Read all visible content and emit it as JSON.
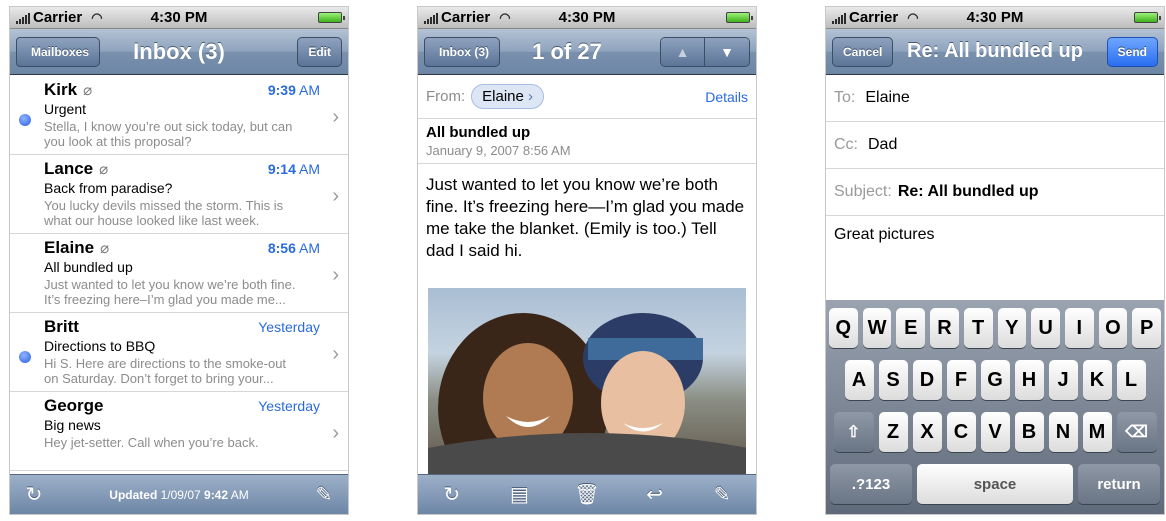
{
  "status": {
    "carrier": "Carrier",
    "time": "4:30 PM"
  },
  "inbox": {
    "back_label": "Mailboxes",
    "title": "Inbox (3)",
    "edit_label": "Edit",
    "messages": [
      {
        "sender": "Kirk",
        "time": "9:39",
        "ampm": "AM",
        "subject": "Urgent",
        "preview1": "Stella, I know you’re out sick today, but can",
        "preview2": "you look at this proposal?"
      },
      {
        "sender": "Lance",
        "time": "9:14",
        "ampm": "AM",
        "subject": "Back from paradise?",
        "preview1": "You lucky devils missed the storm. This is",
        "preview2": "what our house looked like last week."
      },
      {
        "sender": "Elaine",
        "time": "8:56",
        "ampm": "AM",
        "subject": "All bundled up",
        "preview1": "Just wanted to let you know we’re both fine.",
        "preview2": "It’s freezing here–I’m glad you made me..."
      },
      {
        "sender": "Britt",
        "time": "Yesterday",
        "ampm": "",
        "subject": "Directions to BBQ",
        "preview1": "Hi S. Here are directions to the smoke-out",
        "preview2": "on Saturday. Don’t forget to bring your..."
      },
      {
        "sender": "George",
        "time": "Yesterday",
        "ampm": "",
        "subject": "Big news",
        "preview1": "Hey jet-setter. Call when you’re back.",
        "preview2": ""
      }
    ],
    "updated_prefix": "Updated",
    "updated_date": "1/09/07",
    "updated_time": "9:42",
    "updated_ampm": "AM"
  },
  "message": {
    "back_label": "Inbox (3)",
    "title": "1 of 27",
    "from_label": "From:",
    "from_name": "Elaine",
    "details_label": "Details",
    "subject": "All bundled up",
    "date": "January 9, 2007 8:56 AM",
    "body": "Just wanted to let you know we’re both fine. It’s freezing here—I’m glad you made me take the blanket. (Emily is too.) Tell dad I said hi."
  },
  "compose": {
    "cancel_label": "Cancel",
    "title": "Re: All bundled up",
    "send_label": "Send",
    "to_label": "To:",
    "to_value": "Elaine",
    "cc_label": "Cc:",
    "cc_value": "Dad",
    "subject_label": "Subject:",
    "subject_value": "Re: All bundled up",
    "body": "Great pictures",
    "keyboard": {
      "row1": [
        "Q",
        "W",
        "E",
        "R",
        "T",
        "Y",
        "U",
        "I",
        "O",
        "P"
      ],
      "row2": [
        "A",
        "S",
        "D",
        "F",
        "G",
        "H",
        "J",
        "K",
        "L"
      ],
      "row3": [
        "Z",
        "X",
        "C",
        "V",
        "B",
        "N",
        "M"
      ],
      "numbers_label": ".?123",
      "space_label": "space",
      "return_label": "return"
    }
  },
  "icons": [
    "refresh-icon",
    "compose-icon",
    "move-folder-icon",
    "trash-icon",
    "reply-icon",
    "attachment-icon",
    "shift-icon",
    "delete-icon"
  ],
  "colors": {
    "navbar": "#7a91ad",
    "link_blue": "#2a6ae0",
    "unread_dot": "#2a5fe0",
    "send_button": "#2a6ef0"
  }
}
